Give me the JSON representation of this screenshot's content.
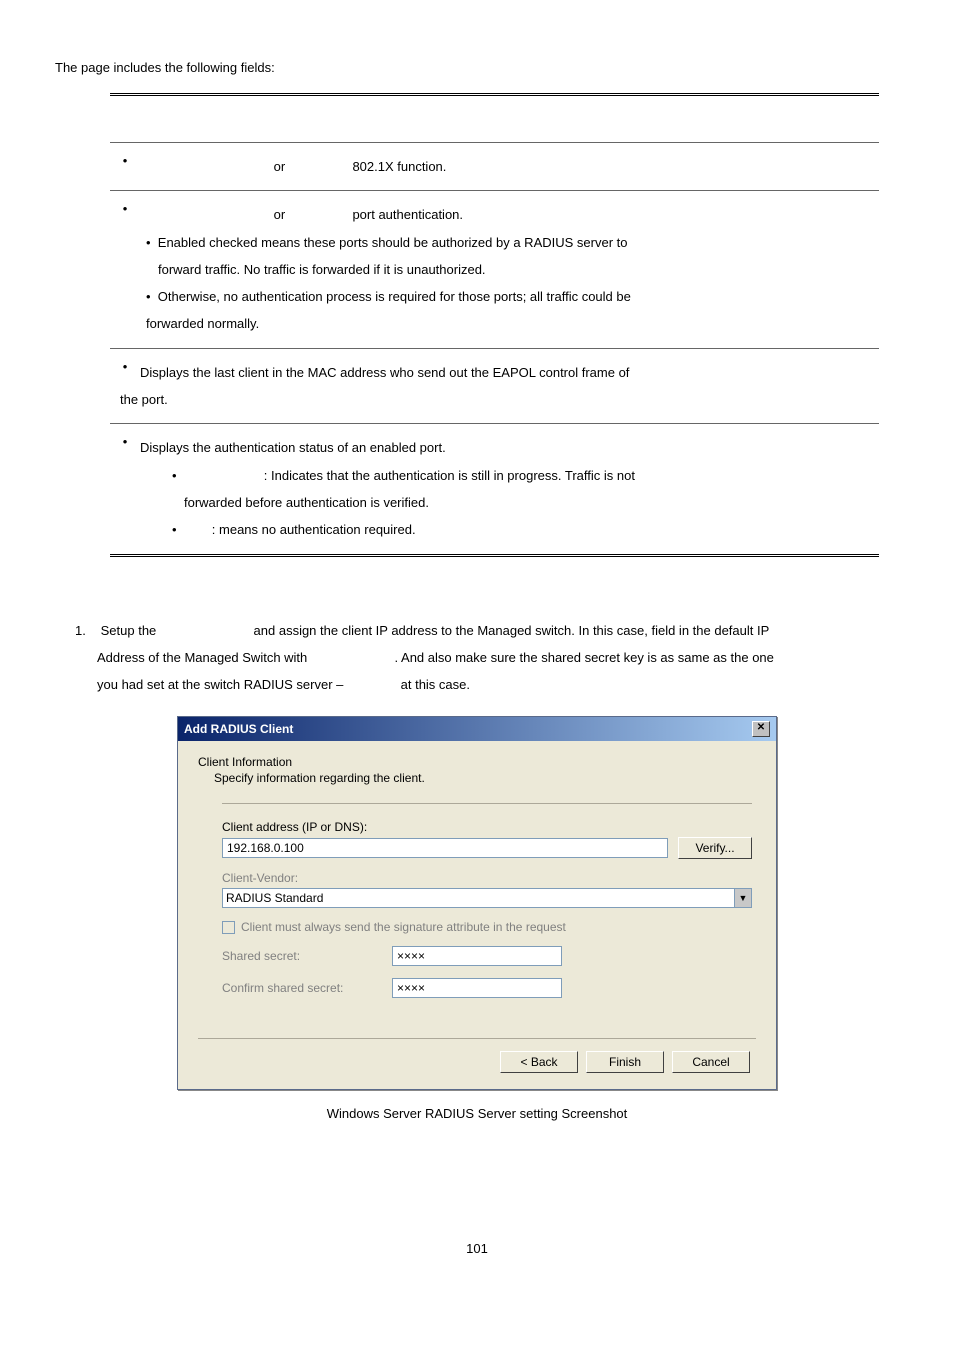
{
  "lead": "The page includes the following fields:",
  "table": {
    "rows": [
      {
        "lines": [
          {
            "pre": "",
            "mid": "or",
            "post": "802.1X function."
          }
        ]
      },
      {
        "lines": [
          {
            "pre": "",
            "mid": "or",
            "post": "port authentication."
          }
        ],
        "subs": [
          "Enabled checked means these ports should be authorized by a RADIUS server to",
          "forward traffic. No traffic is forwarded if it is unauthorized.",
          "Otherwise, no authentication process is required for those ports; all traffic could be",
          "forwarded normally."
        ]
      },
      {
        "plain": [
          "Displays the last client in the MAC address who send out the EAPOL control frame of",
          "the port."
        ]
      },
      {
        "plain": [
          "Displays the authentication status of an enabled port."
        ],
        "dashes": [
          {
            "lead": "",
            "text": ": Indicates that the authentication is still in progress. Traffic is not",
            "cont": "forwarded before authentication is verified."
          },
          {
            "lead": "",
            "text": ": means no authentication required.",
            "cont": ""
          }
        ]
      }
    ]
  },
  "list": {
    "num": "1.",
    "l1a": "Setup the ",
    "l1b": " and assign the client IP address to the Managed switch. In this case, field in the default IP",
    "l2a": "Address of the Managed Switch with ",
    "l2b": ". And also make sure the shared secret key is as same as the one",
    "l3a": "you had set at the switch RADIUS server – ",
    "l3b": " at this case."
  },
  "dialog": {
    "title": "Add RADIUS Client",
    "close": "✕",
    "groupLabel": "Client Information",
    "groupSub": "Specify information regarding the client.",
    "addrLabel": "Client address (IP or DNS):",
    "addrValue": "192.168.0.100",
    "verify": "Verify...",
    "vendorLabel": "Client-Vendor:",
    "vendorValue": "RADIUS Standard",
    "chkLabel": "Client must always send the signature attribute in the request",
    "secretLabel": "Shared secret:",
    "secretValue": "××××",
    "confirmLabel": "Confirm shared secret:",
    "confirmValue": "××××",
    "back": "< Back",
    "finish": "Finish",
    "cancel": "Cancel"
  },
  "caption": "Windows Server RADIUS Server setting Screenshot",
  "pagenum": "101"
}
